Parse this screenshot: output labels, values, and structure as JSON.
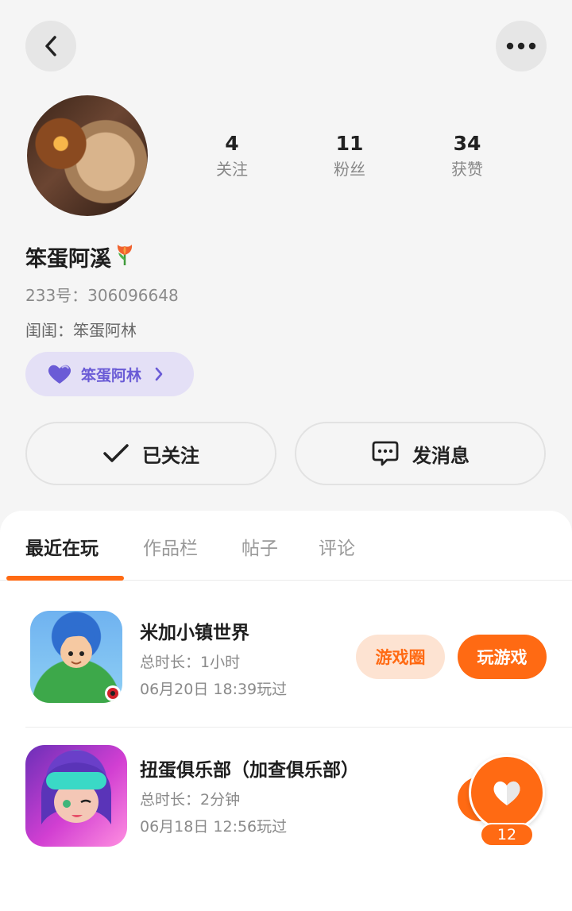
{
  "header": {
    "back_icon": "chevron-left-icon",
    "more_icon": "more-dots-icon"
  },
  "profile": {
    "avatar": "avatar",
    "stats": [
      {
        "value": "4",
        "label": "关注"
      },
      {
        "value": "11",
        "label": "粉丝"
      },
      {
        "value": "34",
        "label": "获赞"
      }
    ],
    "name": "笨蛋阿溪",
    "name_emoji": "tulip-icon",
    "uid": "233号：306096648",
    "bestie_line": "闺闺：笨蛋阿林",
    "bestie_pill": {
      "label": "笨蛋阿林",
      "icon": "purple-heart-icon"
    }
  },
  "actions": {
    "follow_label": "已关注",
    "message_label": "发消息"
  },
  "tabs": [
    {
      "label": "最近在玩",
      "active": true
    },
    {
      "label": "作品栏",
      "active": false
    },
    {
      "label": "帖子",
      "active": false
    },
    {
      "label": "评论",
      "active": false
    }
  ],
  "games": [
    {
      "title": "米加小镇世界",
      "duration": "总时长：1小时",
      "last_played": "06月20日 18:39玩过",
      "circle_label": "游戏圈",
      "play_label": "玩游戏"
    },
    {
      "title": "扭蛋俱乐部（加查俱乐部）",
      "duration": "总时长：2分钟",
      "last_played": "06月18日 12:56玩过"
    }
  ],
  "floating_like": {
    "count": "12",
    "icon": "heart-icon"
  },
  "colors": {
    "accent": "#ff6a13",
    "bestie": "#6a5bd6",
    "bestie_bg": "#e4e0f6"
  }
}
